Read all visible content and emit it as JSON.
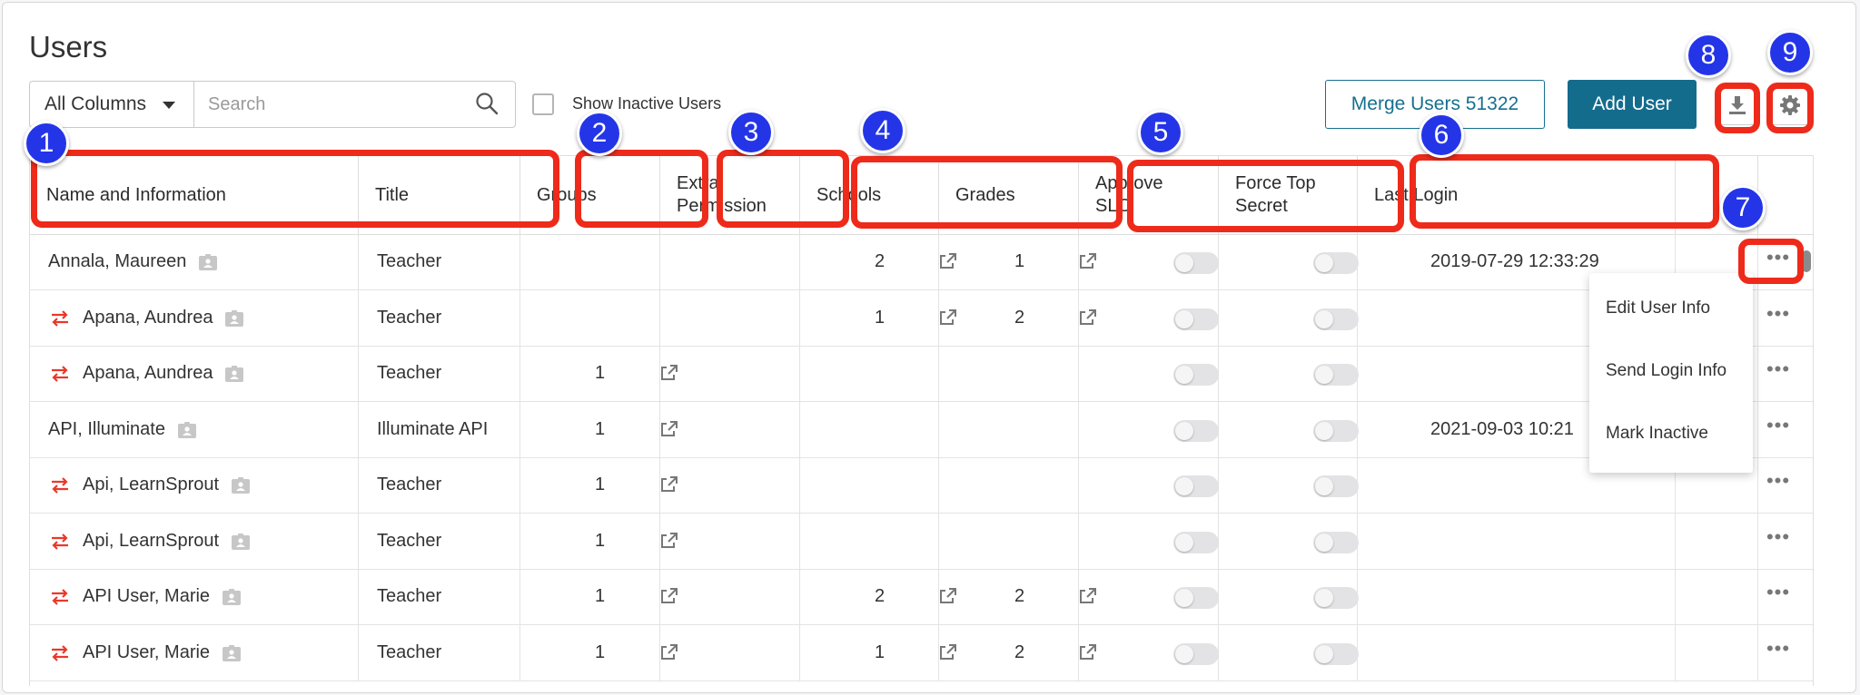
{
  "page": {
    "title": "Users"
  },
  "toolbar": {
    "column_select": "All Columns",
    "search_placeholder": "Search",
    "show_inactive_label": "Show Inactive Users",
    "merge_button": "Merge Users 51322",
    "add_button": "Add User"
  },
  "table": {
    "headers": {
      "name": "Name and Information",
      "title": "Title",
      "groups": "Groups",
      "extra": "Extra Permission",
      "schools": "Schools",
      "grades": "Grades",
      "approve": "Approve SLO",
      "force": "Force Top Secret",
      "last_login": "Last Login"
    },
    "rows": [
      {
        "name": "Annala, Maureen",
        "title": "Teacher",
        "groups": "",
        "schools": "2",
        "grades": "1",
        "last_login": "2019-07-29 12:33:29",
        "linked": false
      },
      {
        "name": "Apana, Aundrea",
        "title": "Teacher",
        "groups": "",
        "schools": "1",
        "grades": "2",
        "last_login": "",
        "linked": true
      },
      {
        "name": "Apana, Aundrea",
        "title": "Teacher",
        "groups": "1",
        "schools": "",
        "grades": "",
        "last_login": "",
        "linked": true
      },
      {
        "name": "API, Illuminate",
        "title": "Illuminate API",
        "groups": "1",
        "schools": "",
        "grades": "",
        "last_login": "2021-09-03 10:21",
        "linked": false
      },
      {
        "name": "Api, LearnSprout",
        "title": "Teacher",
        "groups": "1",
        "schools": "",
        "grades": "",
        "last_login": "",
        "linked": true
      },
      {
        "name": "Api, LearnSprout",
        "title": "Teacher",
        "groups": "1",
        "schools": "",
        "grades": "",
        "last_login": "",
        "linked": true
      },
      {
        "name": "API User, Marie",
        "title": "Teacher",
        "groups": "1",
        "schools": "2",
        "grades": "2",
        "last_login": "",
        "linked": true
      },
      {
        "name": "API User, Marie",
        "title": "Teacher",
        "groups": "1",
        "schools": "1",
        "grades": "2",
        "last_login": "",
        "linked": true
      }
    ]
  },
  "row_menu": {
    "items": [
      "Edit User Info",
      "Send Login Info",
      "Mark Inactive"
    ]
  },
  "annotations": {
    "badges": [
      "1",
      "2",
      "3",
      "4",
      "5",
      "6",
      "7",
      "8",
      "9"
    ]
  },
  "colors": {
    "primary": "#146c8d",
    "annotation_red": "#ee2a1a",
    "badge_blue": "#2435e8",
    "swap_red": "#e8392a"
  }
}
